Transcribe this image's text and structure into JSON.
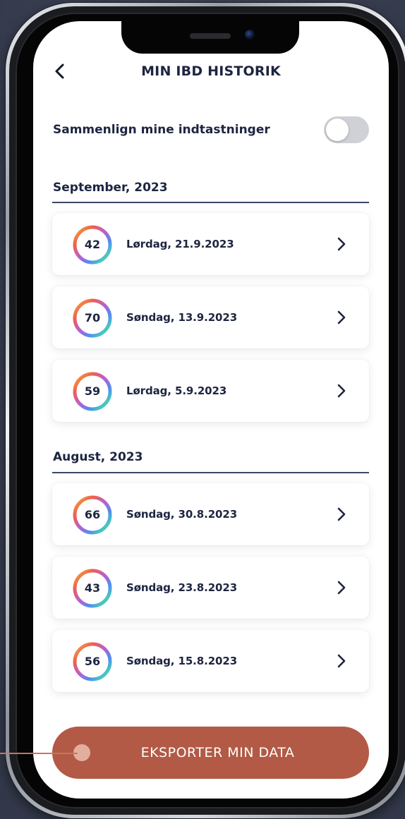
{
  "header": {
    "title": "MIN IBD HISTORIK"
  },
  "compare": {
    "label": "Sammenlign mine indtastninger",
    "enabled": false
  },
  "sections": [
    {
      "heading": "September, 2023",
      "entries": [
        {
          "score": "42",
          "date": "Lørdag, 21.9.2023"
        },
        {
          "score": "70",
          "date": "Søndag, 13.9.2023"
        },
        {
          "score": "59",
          "date": "Lørdag, 5.9.2023"
        }
      ]
    },
    {
      "heading": "August, 2023",
      "entries": [
        {
          "score": "66",
          "date": "Søndag, 30.8.2023"
        },
        {
          "score": "43",
          "date": "Søndag, 23.8.2023"
        },
        {
          "score": "56",
          "date": "Søndag, 15.8.2023"
        }
      ]
    }
  ],
  "export": {
    "label": "EKSPORTER MIN DATA"
  },
  "colors": {
    "text": "#1d2540",
    "accent": "#b25a45",
    "toggle_off": "#cfd1d6",
    "ring_gradient": [
      "#f6b23a",
      "#f0604d",
      "#b65fd6",
      "#4f8ef0",
      "#47c7c1",
      "#7fd16a"
    ]
  },
  "icons": {
    "back": "chevron-left-icon",
    "row_arrow": "chevron-right-icon"
  }
}
